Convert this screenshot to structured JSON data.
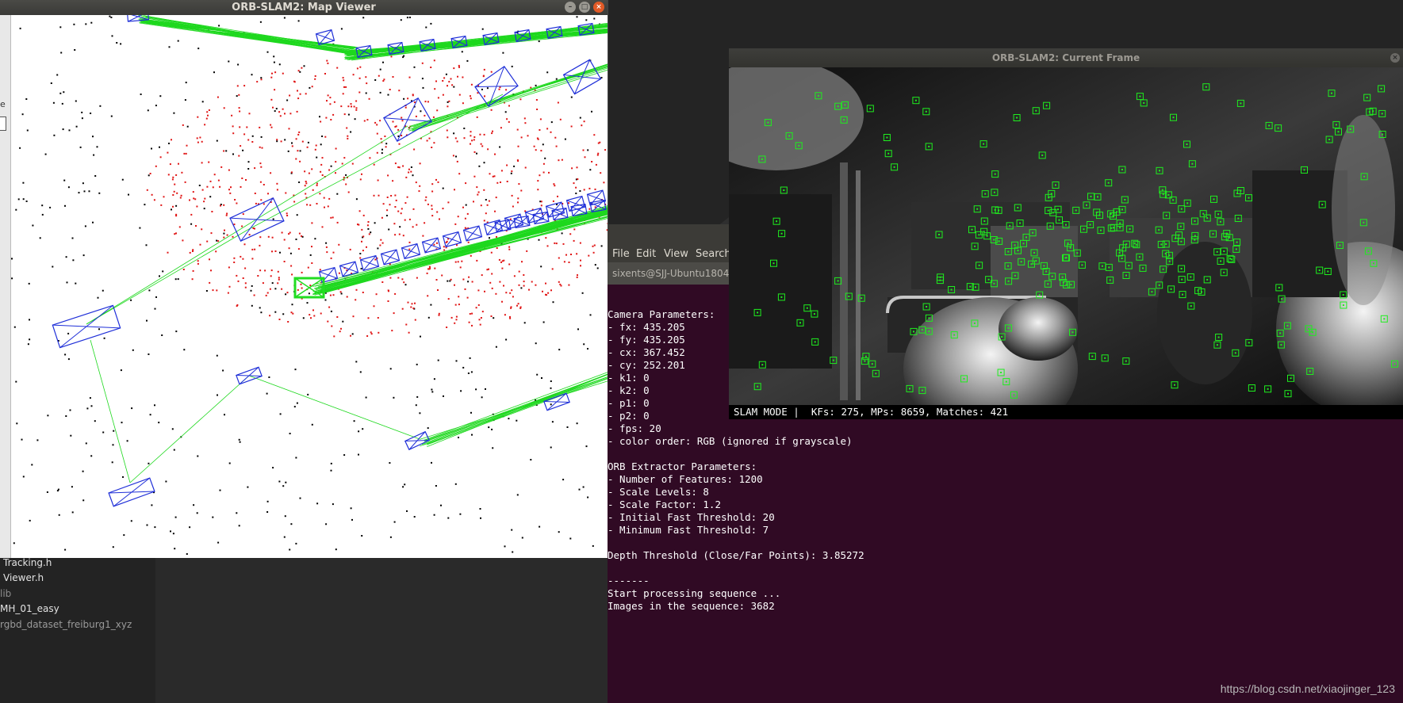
{
  "map_window": {
    "title": "ORB-SLAM2: Map Viewer",
    "panel_label": "e",
    "controls": {
      "minimize": "–",
      "maximize": "□",
      "close": "×"
    }
  },
  "frame_window": {
    "title": "ORB-SLAM2: Current Frame",
    "close": "×",
    "status": {
      "mode": "SLAM MODE |",
      "stats": "KFs: 275, MPs: 8659, Matches: 421"
    }
  },
  "file_list": {
    "items": [
      {
        "label": "Tracking.h",
        "dim": false
      },
      {
        "label": "Viewer.h",
        "dim": false
      },
      {
        "label": "lib",
        "dim": true
      },
      {
        "label": "MH_01_easy",
        "dim": false
      },
      {
        "label": "rgbd_dataset_freiburg1_xyz",
        "dim": false
      }
    ]
  },
  "terminal": {
    "menu": [
      "File",
      "Edit",
      "View",
      "Search"
    ],
    "tab_title": "sixents@SJJ-Ubuntu1804",
    "lines": [
      "Camera Parameters: ",
      "- fx: 435.205",
      "- fy: 435.205",
      "- cx: 367.452",
      "- cy: 252.201",
      "- k1: 0",
      "- k2: 0",
      "- p1: 0",
      "- p2: 0",
      "- fps: 20",
      "- color order: RGB (ignored if grayscale)",
      "",
      "ORB Extractor Parameters: ",
      "- Number of Features: 1200",
      "- Scale Levels: 8",
      "- Scale Factor: 1.2",
      "- Initial Fast Threshold: 20",
      "- Minimum Fast Threshold: 7",
      "",
      "Depth Threshold (Close/Far Points): 3.85272",
      "",
      "-------",
      "Start processing sequence ...",
      "Images in the sequence: 3682"
    ]
  },
  "watermark": "https://blog.csdn.net/xiaojinger_123",
  "colors": {
    "keyframe": "#1f2fd8",
    "graph_edge": "#1ed81e",
    "current_camera": "#22dd22",
    "local_map_point": "#e01515",
    "map_point": "#000000",
    "feature_box": "#1eee1e",
    "terminal_bg": "#300a24"
  }
}
